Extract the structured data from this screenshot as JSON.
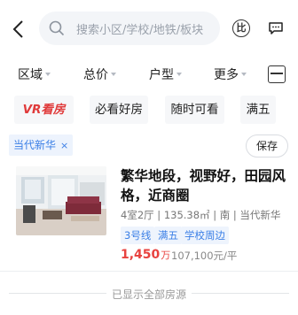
{
  "search": {
    "placeholder": "搜索小区/学校/地铁/板块",
    "compare_label": "比"
  },
  "filters": [
    {
      "label": "区域"
    },
    {
      "label": "总价"
    },
    {
      "label": "户型"
    },
    {
      "label": "更多"
    }
  ],
  "chips": {
    "vr": "VR看房",
    "must_see": "必看好房",
    "anytime": "随时可看",
    "five_years": "满五"
  },
  "selected_tag": {
    "label": "当代新华",
    "close": "×"
  },
  "save_label": "保存",
  "listing": {
    "title": "繁华地段，视野好，田园风格，近商圈",
    "meta": "4室2厅 | 135.38㎡ | 南 | 当代新华",
    "badges": [
      "3号线",
      "满五",
      "学校周边"
    ],
    "price": "1,450",
    "price_unit": "万",
    "unit_price": "107,100元/平"
  },
  "footer_text": "已显示全部房源",
  "colors": {
    "accent_blue": "#3b7fe6",
    "price_red": "#e8423f"
  }
}
